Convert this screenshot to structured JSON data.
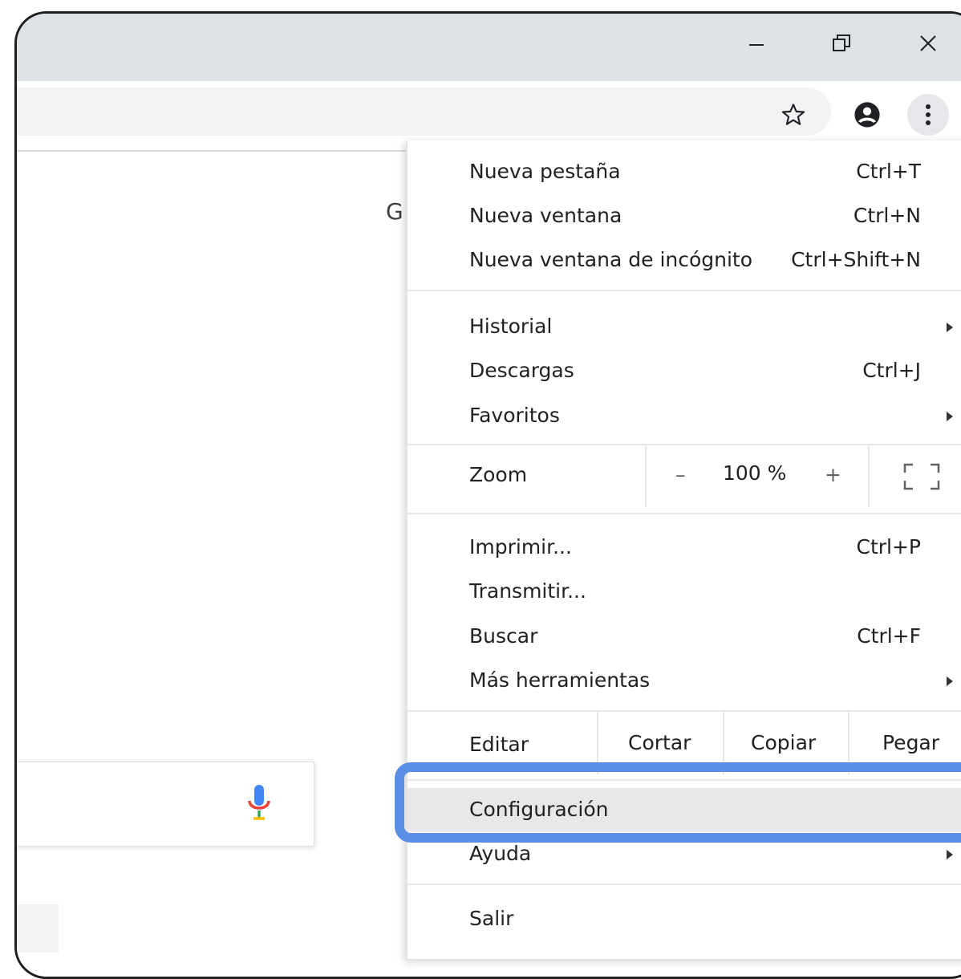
{
  "window": {
    "minimize_icon": "minimize-icon",
    "restore_icon": "restore-icon",
    "close_icon": "close-icon"
  },
  "toolbar": {
    "bookmark_icon": "star-icon",
    "profile_icon": "account-circle-icon",
    "menu_icon": "kebab-menu-icon"
  },
  "page": {
    "partial_letter": "G",
    "mic_icon": "microphone-icon"
  },
  "menu": {
    "new_tab": {
      "label": "Nueva pestaña",
      "shortcut": "Ctrl+T"
    },
    "new_window": {
      "label": "Nueva ventana",
      "shortcut": "Ctrl+N"
    },
    "incognito": {
      "label": "Nueva ventana de incógnito",
      "shortcut": "Ctrl+Shift+N"
    },
    "history": {
      "label": "Historial"
    },
    "downloads": {
      "label": "Descargas",
      "shortcut": "Ctrl+J"
    },
    "bookmarks": {
      "label": "Favoritos"
    },
    "zoom": {
      "label": "Zoom",
      "minus": "–",
      "value": "100 %",
      "plus": "+"
    },
    "print": {
      "label": "Imprimir...",
      "shortcut": "Ctrl+P"
    },
    "cast": {
      "label": "Transmitir..."
    },
    "find": {
      "label": "Buscar",
      "shortcut": "Ctrl+F"
    },
    "more_tools": {
      "label": "Más herramientas"
    },
    "edit": {
      "label": "Editar",
      "cut": "Cortar",
      "copy": "Copiar",
      "paste": "Pegar"
    },
    "settings": {
      "label": "Configuración"
    },
    "help": {
      "label": "Ayuda"
    },
    "exit": {
      "label": "Salir"
    }
  },
  "colors": {
    "highlight": "#5b8ee6",
    "titlebar": "#dee1e6"
  }
}
